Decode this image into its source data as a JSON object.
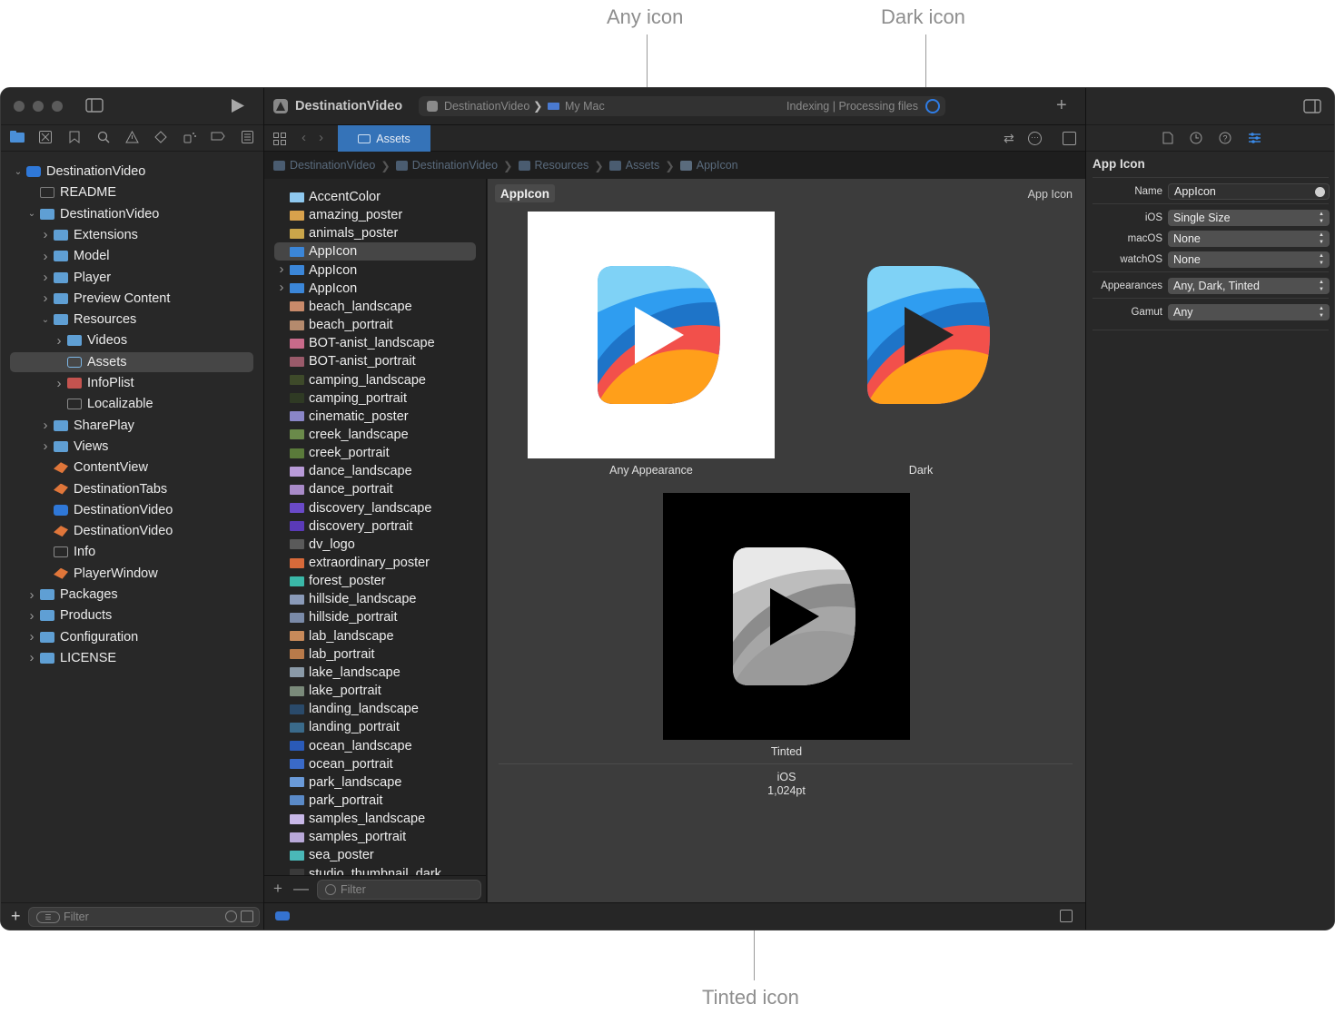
{
  "callouts": {
    "any": "Any icon",
    "dark": "Dark icon",
    "tinted": "Tinted icon"
  },
  "toolbar": {
    "project": "DestinationVideo",
    "scheme": "DestinationVideo",
    "destination": "My Mac",
    "status": "Indexing | Processing files"
  },
  "tab": {
    "label": "Assets"
  },
  "breadcrumb": [
    "DestinationVideo",
    "DestinationVideo",
    "Resources",
    "Assets",
    "AppIcon"
  ],
  "navigator": {
    "items": [
      {
        "label": "DestinationVideo",
        "depth": 0,
        "disc": "down",
        "icon": "app"
      },
      {
        "label": "README",
        "depth": 1,
        "disc": "",
        "icon": "doc"
      },
      {
        "label": "DestinationVideo",
        "depth": 1,
        "disc": "down",
        "icon": "folder"
      },
      {
        "label": "Extensions",
        "depth": 2,
        "disc": "right",
        "icon": "folder"
      },
      {
        "label": "Model",
        "depth": 2,
        "disc": "right",
        "icon": "folder"
      },
      {
        "label": "Player",
        "depth": 2,
        "disc": "right",
        "icon": "folder"
      },
      {
        "label": "Preview Content",
        "depth": 2,
        "disc": "right",
        "icon": "folder"
      },
      {
        "label": "Resources",
        "depth": 2,
        "disc": "down",
        "icon": "folder"
      },
      {
        "label": "Videos",
        "depth": 3,
        "disc": "right",
        "icon": "folder"
      },
      {
        "label": "Assets",
        "depth": 3,
        "disc": "",
        "icon": "asset",
        "selected": true
      },
      {
        "label": "InfoPlist",
        "depth": 3,
        "disc": "right",
        "icon": "plist"
      },
      {
        "label": "Localizable",
        "depth": 3,
        "disc": "",
        "icon": "grid"
      },
      {
        "label": "SharePlay",
        "depth": 2,
        "disc": "right",
        "icon": "folder"
      },
      {
        "label": "Views",
        "depth": 2,
        "disc": "right",
        "icon": "folder"
      },
      {
        "label": "ContentView",
        "depth": 2,
        "disc": "",
        "icon": "swift"
      },
      {
        "label": "DestinationTabs",
        "depth": 2,
        "disc": "",
        "icon": "swift"
      },
      {
        "label": "DestinationVideo",
        "depth": 2,
        "disc": "",
        "icon": "app2"
      },
      {
        "label": "DestinationVideo",
        "depth": 2,
        "disc": "",
        "icon": "swift"
      },
      {
        "label": "Info",
        "depth": 2,
        "disc": "",
        "icon": "grid"
      },
      {
        "label": "PlayerWindow",
        "depth": 2,
        "disc": "",
        "icon": "swift"
      },
      {
        "label": "Packages",
        "depth": 1,
        "disc": "right",
        "icon": "folder"
      },
      {
        "label": "Products",
        "depth": 1,
        "disc": "right",
        "icon": "folder"
      },
      {
        "label": "Configuration",
        "depth": 1,
        "disc": "right",
        "icon": "folder"
      },
      {
        "label": "LICENSE",
        "depth": 1,
        "disc": "right",
        "icon": "folder"
      }
    ],
    "filter_placeholder": "Filter"
  },
  "assets": {
    "items": [
      {
        "label": "AccentColor",
        "color": "#8ec8ef",
        "disc": ""
      },
      {
        "label": "amazing_poster",
        "color": "#d9a24c",
        "disc": ""
      },
      {
        "label": "animals_poster",
        "color": "#c9a54a",
        "disc": ""
      },
      {
        "label": "AppIcon",
        "color": "#3b86d8",
        "disc": "",
        "selected": true
      },
      {
        "label": "AppIcon",
        "color": "#3b86d8",
        "disc": "right"
      },
      {
        "label": "AppIcon",
        "color": "#3b86d8",
        "disc": "right"
      },
      {
        "label": "beach_landscape",
        "color": "#c98a6a",
        "disc": ""
      },
      {
        "label": "beach_portrait",
        "color": "#b58a6d",
        "disc": ""
      },
      {
        "label": "BOT-anist_landscape",
        "color": "#c86a8a",
        "disc": ""
      },
      {
        "label": "BOT-anist_portrait",
        "color": "#9a5a6a",
        "disc": ""
      },
      {
        "label": "camping_landscape",
        "color": "#3e4a2a",
        "disc": ""
      },
      {
        "label": "camping_portrait",
        "color": "#2f3a24",
        "disc": ""
      },
      {
        "label": "cinematic_poster",
        "color": "#8a86c8",
        "disc": ""
      },
      {
        "label": "creek_landscape",
        "color": "#6a8a4a",
        "disc": ""
      },
      {
        "label": "creek_portrait",
        "color": "#5a7a3a",
        "disc": ""
      },
      {
        "label": "dance_landscape",
        "color": "#b89ad8",
        "disc": ""
      },
      {
        "label": "dance_portrait",
        "color": "#a88ac8",
        "disc": ""
      },
      {
        "label": "discovery_landscape",
        "color": "#6a4ac8",
        "disc": ""
      },
      {
        "label": "discovery_portrait",
        "color": "#5a3ab8",
        "disc": ""
      },
      {
        "label": "dv_logo",
        "color": "#5a5a5a",
        "disc": ""
      },
      {
        "label": "extraordinary_poster",
        "color": "#d86a3a",
        "disc": ""
      },
      {
        "label": "forest_poster",
        "color": "#3ab8a8",
        "disc": ""
      },
      {
        "label": "hillside_landscape",
        "color": "#8a9ab8",
        "disc": ""
      },
      {
        "label": "hillside_portrait",
        "color": "#7a8aa8",
        "disc": ""
      },
      {
        "label": "lab_landscape",
        "color": "#c88a5a",
        "disc": ""
      },
      {
        "label": "lab_portrait",
        "color": "#b87a4a",
        "disc": ""
      },
      {
        "label": "lake_landscape",
        "color": "#8a9aa8",
        "disc": ""
      },
      {
        "label": "lake_portrait",
        "color": "#7a8a7a",
        "disc": ""
      },
      {
        "label": "landing_landscape",
        "color": "#2a4a6a",
        "disc": ""
      },
      {
        "label": "landing_portrait",
        "color": "#3a6a8a",
        "disc": ""
      },
      {
        "label": "ocean_landscape",
        "color": "#2a5ab8",
        "disc": ""
      },
      {
        "label": "ocean_portrait",
        "color": "#3a6ac8",
        "disc": ""
      },
      {
        "label": "park_landscape",
        "color": "#6a9ad8",
        "disc": ""
      },
      {
        "label": "park_portrait",
        "color": "#5a8ac8",
        "disc": ""
      },
      {
        "label": "samples_landscape",
        "color": "#c8b8e8",
        "disc": ""
      },
      {
        "label": "samples_portrait",
        "color": "#b8a8d8",
        "disc": ""
      },
      {
        "label": "sea_poster",
        "color": "#4ab8b8",
        "disc": ""
      },
      {
        "label": "studio_thumbnail_dark",
        "color": "#3a3a3a",
        "disc": ""
      }
    ],
    "filter_placeholder": "Filter"
  },
  "canvas": {
    "set_name": "AppIcon",
    "set_type": "App Icon",
    "any_label": "Any Appearance",
    "dark_label": "Dark",
    "tinted_label": "Tinted",
    "platform": "iOS",
    "size": "1,024pt"
  },
  "inspector": {
    "title": "App Icon",
    "rows": [
      {
        "label": "Name",
        "value": "AppIcon",
        "kind": "text"
      },
      {
        "label": "iOS",
        "value": "Single Size",
        "kind": "popup"
      },
      {
        "label": "macOS",
        "value": "None",
        "kind": "popup"
      },
      {
        "label": "watchOS",
        "value": "None",
        "kind": "popup"
      },
      {
        "label": "Appearances",
        "value": "Any, Dark, Tinted",
        "kind": "popup"
      },
      {
        "label": "Gamut",
        "value": "Any",
        "kind": "popup"
      }
    ]
  },
  "colors": {
    "accent": "#3573b8",
    "icon_blue": "#2f9df0",
    "icon_orange": "#ff9f1a",
    "icon_red": "#f2504b"
  }
}
